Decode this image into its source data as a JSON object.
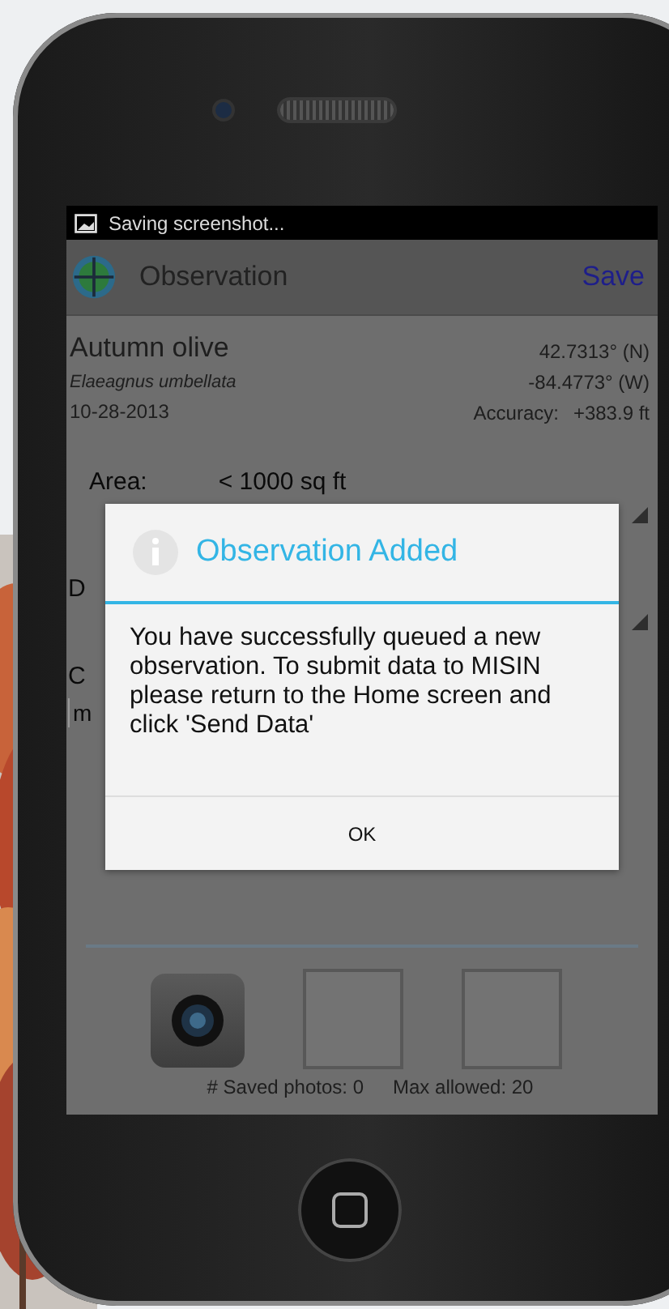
{
  "status_bar": {
    "notification": "Saving screenshot..."
  },
  "action_bar": {
    "title": "Observation",
    "action": "Save"
  },
  "observation": {
    "common_name": "Autumn olive",
    "scientific_name": "Elaeagnus umbellata",
    "date": "10-28-2013",
    "latitude": "42.7313° (N)",
    "longitude": "-84.4773° (W)",
    "accuracy_label": "Accuracy:",
    "accuracy": "+383.9 ft"
  },
  "form": {
    "area_label": "Area:",
    "area_value": "< 1000 sq ft",
    "row_2_label": "D",
    "row_3_label": "C",
    "comment_placeholder": "m"
  },
  "dialog": {
    "title": "Observation Added",
    "message": "You have successfully queued a new observation. To submit data to MISIN please return to the Home screen and click 'Send Data'",
    "buttons": [
      "OK"
    ]
  },
  "photos": {
    "slots": [
      {
        "kind": "camera"
      },
      {
        "kind": "empty"
      },
      {
        "kind": "empty"
      }
    ],
    "saved": "# Saved photos: 0",
    "max": "Max allowed: 20"
  }
}
